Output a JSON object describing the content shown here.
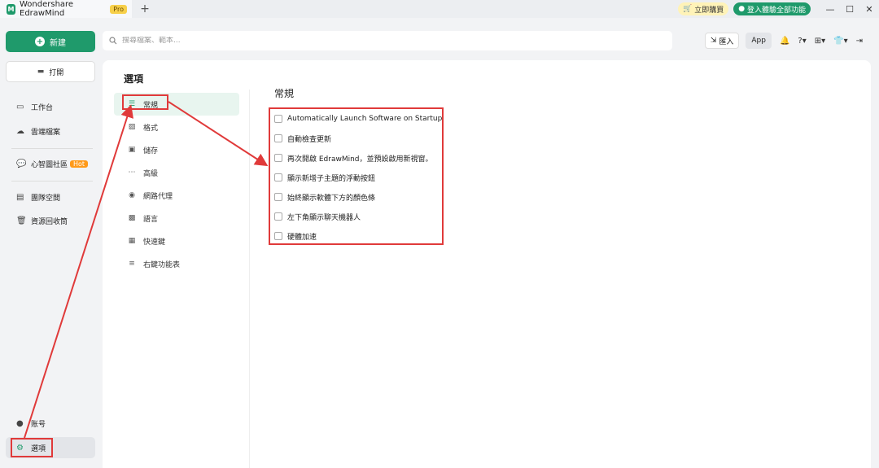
{
  "titlebar": {
    "app_name": "Wondershare EdrawMind",
    "pro_badge": "Pro",
    "new_tab": "+",
    "buy_label": "立即購買",
    "login_label": "登入體驗全部功能"
  },
  "toolbar": {
    "new_label": "新建",
    "search_placeholder": "搜尋檔案、範本...",
    "import_label": "匯入",
    "app_label": "App"
  },
  "sidebar": {
    "open_label": "打開",
    "items": [
      {
        "label": "工作台",
        "icon": "home-icon"
      },
      {
        "label": "雲端檔案",
        "icon": "cloud-icon"
      },
      {
        "label": "心智圖社區",
        "icon": "community-icon",
        "badge": "Hot"
      },
      {
        "label": "團隊空間",
        "icon": "team-icon"
      },
      {
        "label": "資源回收筒",
        "icon": "trash-icon"
      }
    ],
    "account_label": "账号",
    "options_label": "選項"
  },
  "options_panel": {
    "title": "選項",
    "categories": [
      {
        "label": "常規",
        "icon": "general-icon",
        "active": true
      },
      {
        "label": "格式",
        "icon": "format-icon",
        "active": false
      },
      {
        "label": "儲存",
        "icon": "save-icon",
        "active": false
      },
      {
        "label": "高級",
        "icon": "advanced-icon",
        "active": false
      },
      {
        "label": "網路代理",
        "icon": "proxy-icon",
        "active": false
      },
      {
        "label": "語言",
        "icon": "language-icon",
        "active": false
      },
      {
        "label": "快速鍵",
        "icon": "shortcut-icon",
        "active": false
      },
      {
        "label": "右鍵功能表",
        "icon": "context-menu-icon",
        "active": false
      }
    ]
  },
  "general_settings": {
    "title": "常規",
    "options": [
      {
        "label": "Automatically Launch Software on Startup",
        "checked": false
      },
      {
        "label": "自動檢查更新",
        "checked": false
      },
      {
        "label": "再次開啟 EdrawMind，並預設啟用新視窗。",
        "checked": false
      },
      {
        "label": "顯示新增子主題的浮動按鈕",
        "checked": false
      },
      {
        "label": "始終顯示軟體下方的顏色條",
        "checked": false
      },
      {
        "label": "左下角顯示聊天機器人",
        "checked": false
      },
      {
        "label": "硬體加速",
        "checked": false
      }
    ]
  },
  "colors": {
    "brand": "#1f9a6b",
    "annotation": "#e03a3a"
  }
}
